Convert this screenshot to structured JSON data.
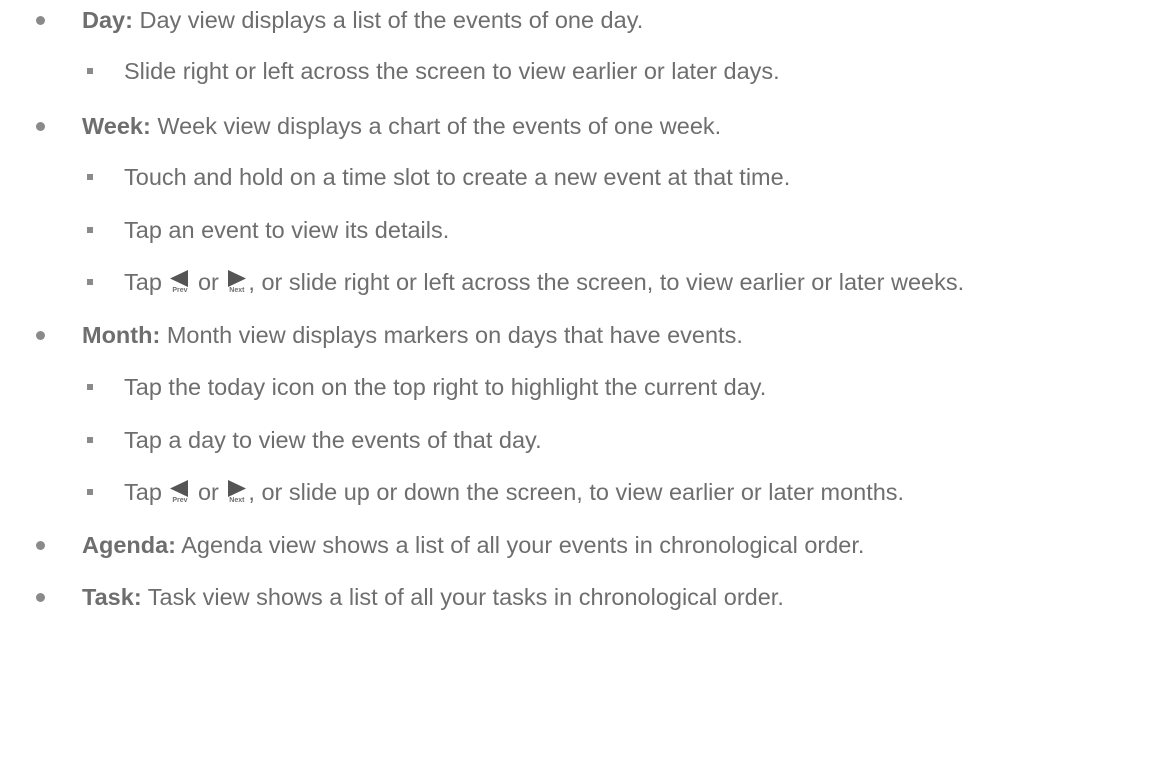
{
  "items": [
    {
      "term": "Day:",
      "text": " Day view displays a list of the events of one day.",
      "subs": [
        {
          "text": "Slide right or left across the screen to view earlier or later days."
        }
      ]
    },
    {
      "term": "Week:",
      "text": " Week view displays a chart of the events of one week.",
      "subs": [
        {
          "text": "Touch and hold on a time slot to create a new event at that time."
        },
        {
          "text": "Tap an event to view its details."
        },
        {
          "pre": "Tap ",
          "mid": " or ",
          "post": ", or slide right or left across the screen, to view earlier or later weeks."
        }
      ]
    },
    {
      "term": "Month:",
      "text": " Month view displays markers on days that have events.",
      "subs": [
        {
          "text": "Tap the today icon on the top right to highlight the current day."
        },
        {
          "text": "Tap a day to view the events of that day."
        },
        {
          "pre": "Tap ",
          "mid": " or ",
          "post": ", or slide up or down the screen, to view earlier or later months."
        }
      ]
    },
    {
      "term": "Agenda:",
      "text": " Agenda view shows a list of all your events in chronological order."
    },
    {
      "term": "Task:",
      "text": " Task view shows a list of all your tasks in chronological order."
    }
  ],
  "icons": {
    "prev_caption": "Prev",
    "next_caption": "Next",
    "prev_icon": "triangle-left-icon",
    "next_icon": "triangle-right-icon"
  },
  "colors": {
    "text": "#6e6e6e",
    "bullet": "#8a8a8a",
    "icon": "#555555"
  }
}
